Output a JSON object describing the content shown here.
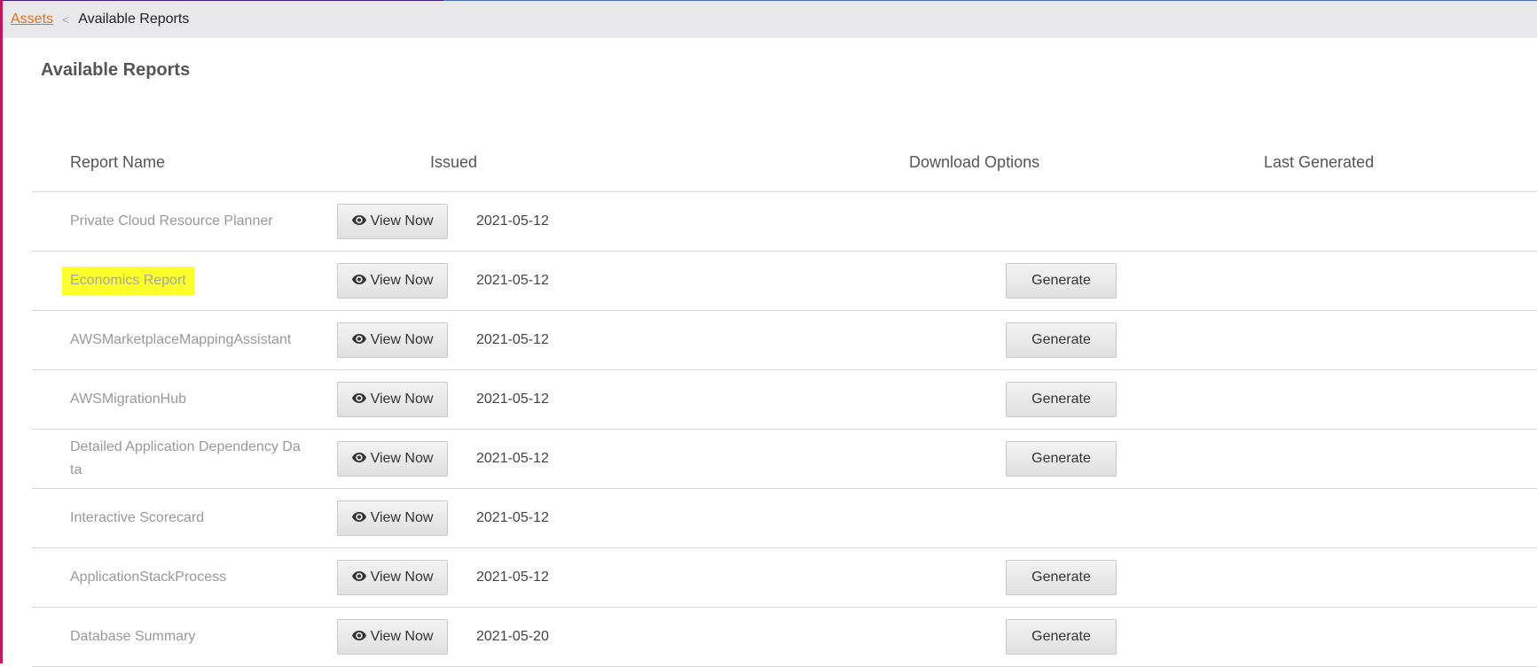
{
  "breadcrumb": {
    "root": "Assets",
    "separator": "<",
    "current": "Available Reports"
  },
  "page_title": "Available Reports",
  "table": {
    "headers": {
      "name": "Report Name",
      "issued": "Issued",
      "download": "Download Options",
      "last_generated": "Last Generated"
    },
    "view_label": "View Now",
    "generate_label": "Generate",
    "rows": [
      {
        "name": "Private Cloud Resource Planner",
        "issued": "2021-05-12",
        "generate": false,
        "highlighted": false
      },
      {
        "name": "Economics Report",
        "issued": "2021-05-12",
        "generate": true,
        "highlighted": true
      },
      {
        "name": "AWSMarketplaceMappingAssistant",
        "issued": "2021-05-12",
        "generate": true,
        "highlighted": false
      },
      {
        "name": "AWSMigrationHub",
        "issued": "2021-05-12",
        "generate": true,
        "highlighted": false
      },
      {
        "name": "Detailed Application Dependency Da ta",
        "issued": "2021-05-12",
        "generate": true,
        "highlighted": false
      },
      {
        "name": "Interactive Scorecard",
        "issued": "2021-05-12",
        "generate": false,
        "highlighted": false
      },
      {
        "name": "ApplicationStackProcess",
        "issued": "2021-05-12",
        "generate": true,
        "highlighted": false
      },
      {
        "name": "Database Summary",
        "issued": "2021-05-20",
        "generate": true,
        "highlighted": false
      }
    ]
  },
  "icons": {
    "view": "eye-icon"
  },
  "colors": {
    "link": "#e8701a",
    "highlight": "#fbff2a",
    "breadcrumb_bg": "#e9e9eb"
  }
}
